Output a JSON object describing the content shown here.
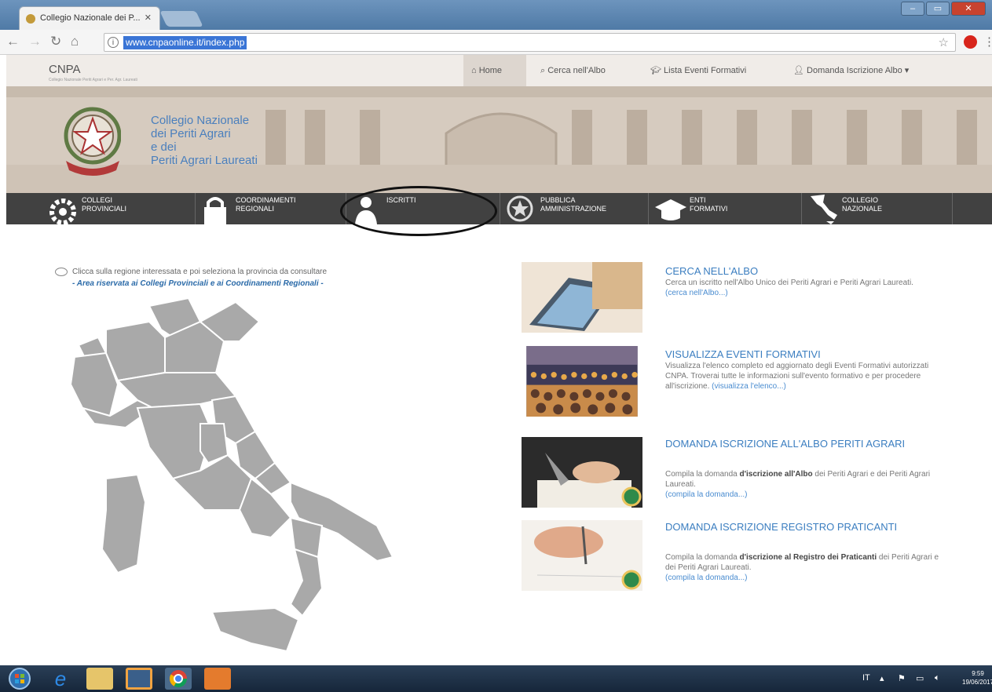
{
  "browser": {
    "tab_title": "Collegio Nazionale dei P...",
    "url": "www.cnpaonline.it/index.php"
  },
  "site": {
    "brand": "CNPA",
    "brand_sub": "Collegio Nazionale Periti Agrari e Per. Agr. Laureati",
    "menu": [
      {
        "label": "Home",
        "icon": "home-icon"
      },
      {
        "label": "Cerca nell'Albo",
        "icon": "search-icon"
      },
      {
        "label": "Lista Eventi Formativi",
        "icon": "graduation-cap-icon"
      },
      {
        "label": "Domanda Iscrizione Albo",
        "icon": "user-add-icon"
      }
    ],
    "hero_lines": [
      "Collegio Nazionale",
      "dei Periti Agrari",
      "e dei",
      "Periti Agrari Laureati"
    ]
  },
  "band": [
    {
      "label": "COLLEGI\nPROVINCIALI",
      "icon": "gear-icon"
    },
    {
      "label": "COORDINAMENTI\nREGIONALI",
      "icon": "lock-icon"
    },
    {
      "label": "ISCRITTI",
      "icon": "user-icon"
    },
    {
      "label": "PUBBLICA\nAMMINISTRAZIONE",
      "icon": "emblem-icon"
    },
    {
      "label": "ENTI\nFORMATIVI",
      "icon": "graduation-cap-icon"
    },
    {
      "label": "COLLEGIO\nNAZIONALE",
      "icon": "italy-icon"
    }
  ],
  "map": {
    "hint": "Clicca sulla regione interessata e poi seleziona la provincia da consultare",
    "restricted": "- Area riservata ai Collegi Provinciali e ai Coordinamenti Regionali -"
  },
  "cards": [
    {
      "title": "CERCA NELL'ALBO",
      "text": "Cerca un iscritto nell'Albo Unico dei Periti Agrari e Periti Agrari Laureati.",
      "link": "(cerca nell'Albo...)"
    },
    {
      "title": "VISUALIZZA EVENTI FORMATIVI",
      "text": "Visualizza l'elenco completo ed aggiornato degli Eventi Formativi autorizzati CNPA. Troverai tutte le informazioni sull'evento formativo e per procedere all'iscrizione.",
      "link": "(visualizza l'elenco...)"
    },
    {
      "title": "DOMANDA ISCRIZIONE ALL'ALBO PERITI AGRARI",
      "text_pre": "Compila la domanda ",
      "text_bold": "d'iscrizione all'Albo",
      "text_post": " dei Periti Agrari e dei Periti Agrari Laureati.",
      "link": "(compila la domanda...)"
    },
    {
      "title": "DOMANDA ISCRIZIONE REGISTRO PRATICANTI",
      "text_pre": "Compila la domanda ",
      "text_bold": "d'iscrizione al Registro dei Praticanti",
      "text_post": " dei Periti Agrari e dei Periti Agrari Laureati.",
      "link": "(compila la domanda...)"
    }
  ],
  "taskbar": {
    "lang": "IT",
    "time": "9:59",
    "date": "19/06/2017"
  },
  "colors": {
    "accent": "#3b7ec0",
    "band": "#414141",
    "map_region": "#a9a9a9"
  }
}
